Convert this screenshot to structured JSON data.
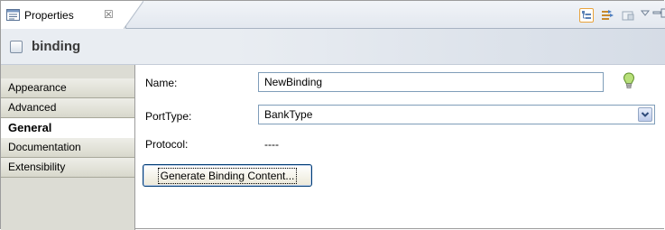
{
  "view": {
    "tab_label": "Properties",
    "tab_icon": "properties-view-icon",
    "close_glyph": "☒",
    "toolbar_icons": [
      "show-categories-icon",
      "link-with-editor-icon",
      "pin-icon",
      "view-menu-icon",
      "minimize-icon",
      "maximize-icon"
    ]
  },
  "header": {
    "title": "binding",
    "icon": "binding-icon"
  },
  "nav": {
    "items": [
      {
        "label": "Appearance",
        "active": false
      },
      {
        "label": "Advanced",
        "active": false
      },
      {
        "label": "General",
        "active": true
      },
      {
        "label": "Documentation",
        "active": false
      },
      {
        "label": "Extensibility",
        "active": false
      }
    ]
  },
  "form": {
    "name_label": "Name:",
    "name_value": "NewBinding",
    "porttype_label": "PortType:",
    "porttype_value": "BankType",
    "protocol_label": "Protocol:",
    "protocol_value": "----",
    "generate_button": "Generate Binding Content..."
  },
  "colors": {
    "accent_border": "#7f9db9",
    "nav_background": "#dcdcd4",
    "bulb": "#7fbf3f"
  }
}
